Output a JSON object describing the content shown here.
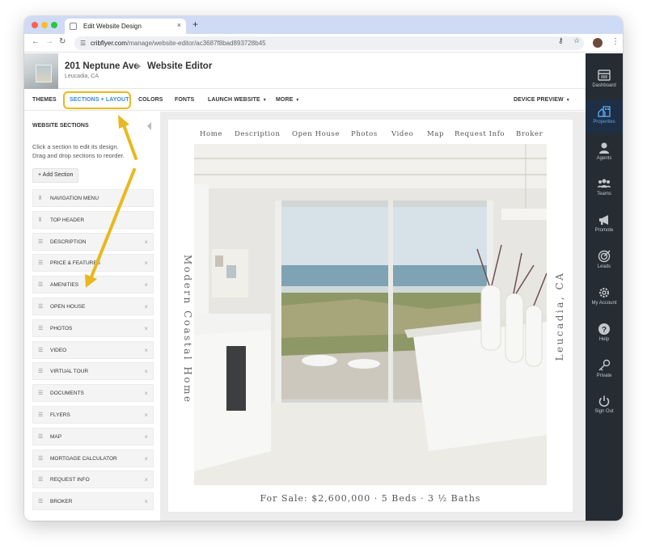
{
  "browser": {
    "tab_title": "Edit Website Design",
    "tab_close": "×",
    "new_tab": "+",
    "url_domain": "cribflyer.com",
    "url_path": "/manage/website-editor/ac3687f8bad893728b45"
  },
  "property": {
    "address": "201 Neptune Ave",
    "city": "Leucadia, CA",
    "editor_title": "Website Editor"
  },
  "menu": {
    "themes": "THEMES",
    "sections_layout": "SECTIONS + LAYOUT",
    "colors": "COLORS",
    "fonts": "FONTS",
    "launch_website": "LAUNCH WEBSITE",
    "more": "MORE",
    "device_preview": "DEVICE PREVIEW"
  },
  "sidebar": {
    "heading": "WEBSITE SECTIONS",
    "help_line1": "Click a section to edit its design.",
    "help_line2": "Drag and drop sections to reorder.",
    "add_section": "+ Add Section",
    "sections": [
      {
        "label": "NAVIGATION MENU",
        "pinned": true
      },
      {
        "label": "TOP HEADER",
        "pinned": true
      },
      {
        "label": "DESCRIPTION",
        "pinned": false
      },
      {
        "label": "PRICE & FEATURES",
        "pinned": false
      },
      {
        "label": "AMENITIES",
        "pinned": false
      },
      {
        "label": "OPEN HOUSE",
        "pinned": false
      },
      {
        "label": "PHOTOS",
        "pinned": false
      },
      {
        "label": "VIDEO",
        "pinned": false
      },
      {
        "label": "VIRTUAL TOUR",
        "pinned": false
      },
      {
        "label": "DOCUMENTS",
        "pinned": false
      },
      {
        "label": "FLYERS",
        "pinned": false
      },
      {
        "label": "MAP",
        "pinned": false
      },
      {
        "label": "MORTGAGE CALCULATOR",
        "pinned": false
      },
      {
        "label": "REQUEST INFO",
        "pinned": false
      },
      {
        "label": "BROKER",
        "pinned": false
      }
    ]
  },
  "preview": {
    "nav": [
      "Home",
      "Description",
      "Open House",
      "Photos",
      "Video",
      "Map",
      "Request Info",
      "Broker"
    ],
    "left_caption": "Modern Coastal Home",
    "right_caption": "Leucadia, CA",
    "tagline": "For Sale: $2,600,000 · 5 Beds · 3 ½ Baths"
  },
  "rail": {
    "items": [
      {
        "label": "Dashboard",
        "icon": "dashboard-icon"
      },
      {
        "label": "Properties",
        "icon": "properties-icon",
        "active": true
      },
      {
        "label": "Agents",
        "icon": "agent-icon"
      },
      {
        "label": "Teams",
        "icon": "teams-icon"
      },
      {
        "label": "Promote",
        "icon": "megaphone-icon"
      },
      {
        "label": "Leads",
        "icon": "target-icon"
      },
      {
        "label": "My Account",
        "icon": "gear-icon"
      },
      {
        "label": "Help",
        "icon": "help-icon"
      },
      {
        "label": "Private",
        "icon": "key-icon"
      },
      {
        "label": "Sign Out",
        "icon": "power-icon"
      }
    ]
  },
  "colors": {
    "accent": "#3a86d6",
    "highlight": "#eab81e",
    "rail_bg": "#252c33"
  }
}
